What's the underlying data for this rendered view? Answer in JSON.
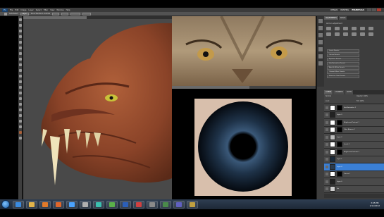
{
  "menubar": {
    "logo": "Ps",
    "items": [
      "File",
      "Edit",
      "Image",
      "Layer",
      "Select",
      "Filter",
      "View",
      "Window",
      "Help"
    ],
    "workspaces": [
      "DESIGN",
      "PAINTING",
      "ESSENTIALS"
    ],
    "active_workspace": "ESSENTIALS"
  },
  "options_bar": {
    "buttons": [
      "Auto-Select",
      "Show Transform Controls"
    ],
    "labels": [
      "Layer"
    ]
  },
  "documents": {
    "dragon_tab": "",
    "eye_tab": ""
  },
  "right_panel": {
    "top_tabs": [
      "ADJUSTMENTS",
      "MASKS"
    ],
    "adjust_title": "Add an adjustment",
    "presets": [
      "Levels Presets",
      "Curves Presets",
      "Exposure Presets",
      "Hue/Saturation Presets",
      "Black & White Presets",
      "Channel Mixer Presets",
      "Selective Color Presets"
    ],
    "layers_tabs": [
      "LAYERS",
      "CHANNELS",
      "PATHS"
    ],
    "blend_mode": "Normal",
    "opacity_label": "Opacity: 100%",
    "lock_label": "Lock:",
    "fill_label": "Fill: 100%",
    "layers": [
      {
        "name": "Hue/Saturation 1",
        "thumb": "#ffffff",
        "mask": true,
        "selected": false
      },
      {
        "name": "Layer 3",
        "thumb": "#222222",
        "mask": false,
        "selected": false
      },
      {
        "name": "Brightness/Contrast 1",
        "thumb": "#ffffff",
        "mask": true,
        "selected": false
      },
      {
        "name": "Color Balance 1",
        "thumb": "#ffffff",
        "mask": true,
        "selected": false
      },
      {
        "name": "Layer 2",
        "thumb": "#bbbbbb",
        "mask": false,
        "selected": false
      },
      {
        "name": "Levels 1",
        "thumb": "#ffffff",
        "mask": true,
        "selected": false
      },
      {
        "name": "Brightness/Contrast 2",
        "thumb": "#ffffff",
        "mask": true,
        "selected": false
      },
      {
        "name": "Layer 1",
        "thumb": "#1a2a3a",
        "mask": false,
        "selected": false
      },
      {
        "name": "Layer 4",
        "thumb": "#2a3c50",
        "mask": false,
        "selected": true
      },
      {
        "name": "Curves 1",
        "thumb": "#ffffff",
        "mask": true,
        "selected": false
      },
      {
        "name": "Layer 0",
        "thumb": "#202020",
        "mask": false,
        "selected": false
      },
      {
        "name": "Iris",
        "thumb": "#cccccc",
        "mask": false,
        "selected": false
      }
    ]
  },
  "taskbar": {
    "apps": [
      {
        "icon": "ie-icon",
        "color": "#3a8be0"
      },
      {
        "icon": "folder-icon",
        "color": "#e0b34a"
      },
      {
        "icon": "media-icon",
        "color": "#e07a2a"
      },
      {
        "icon": "firefox-icon",
        "color": "#e0662a"
      },
      {
        "icon": "photoshop-icon",
        "color": "#4aa3ff"
      },
      {
        "icon": "zbrush-icon",
        "color": "#b0b0b0"
      },
      {
        "icon": "maya-icon",
        "color": "#3bbfb0"
      },
      {
        "icon": "camtasia-icon",
        "color": "#5ab04a"
      },
      {
        "icon": "word-icon",
        "color": "#2b5fb8"
      },
      {
        "icon": "app-icon",
        "color": "#d04040"
      },
      {
        "icon": "app-icon",
        "color": "#8a8a8a"
      },
      {
        "icon": "app-icon",
        "color": "#4a8a4a"
      },
      {
        "icon": "app-icon",
        "color": "#6060c0"
      },
      {
        "icon": "app-icon",
        "color": "#c0a040"
      }
    ],
    "time": "3:05 PM",
    "date": "1/11/2012"
  }
}
